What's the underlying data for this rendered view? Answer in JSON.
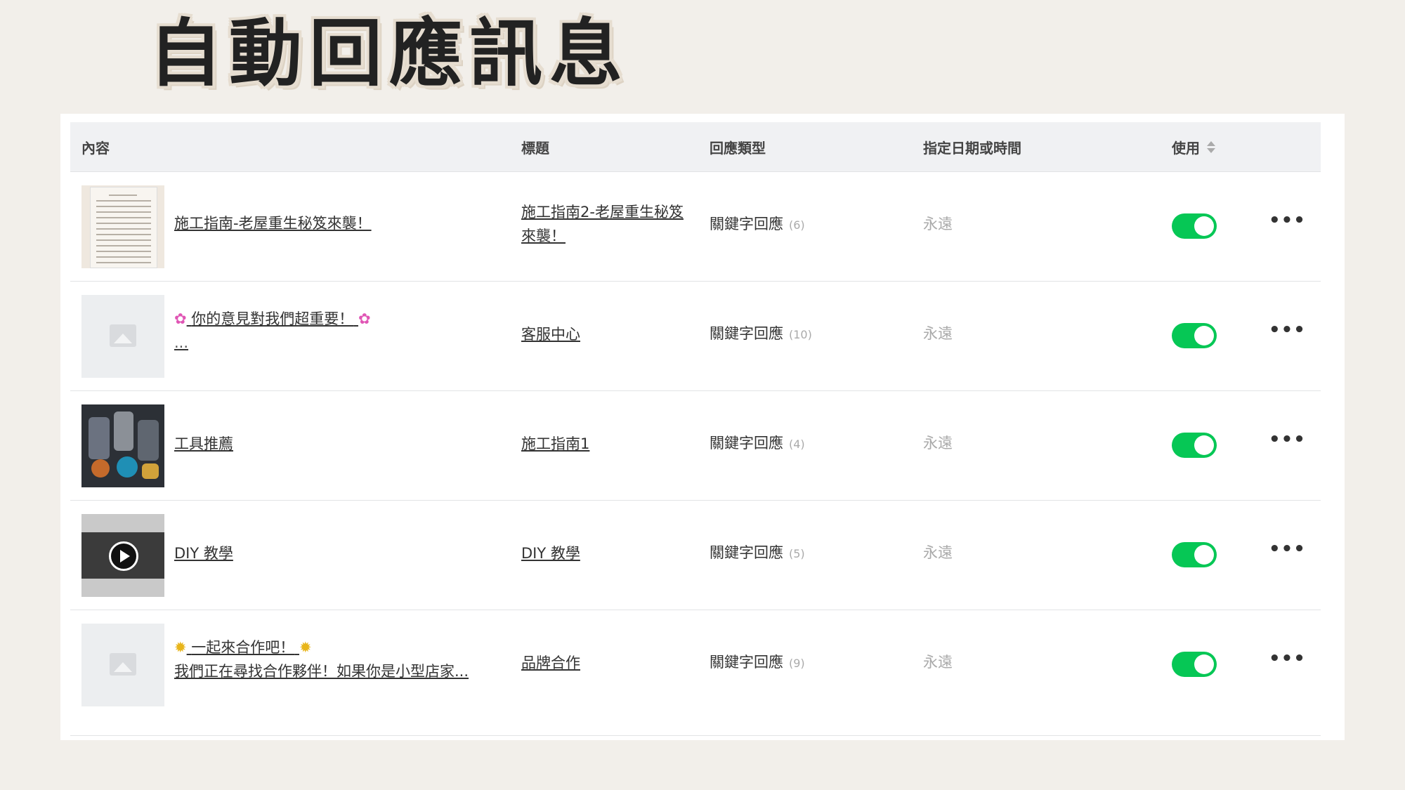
{
  "page_title": "自動回應訊息",
  "table": {
    "headers": {
      "content": "內容",
      "title": "標題",
      "type": "回應類型",
      "date": "指定日期或時間",
      "enabled": "使用"
    },
    "rows": [
      {
        "thumbnail": "document-image",
        "content_line1": "施工指南-老屋重生秘笈來襲！",
        "content_line2": "",
        "title": "施工指南2-老屋重生秘笈來襲！",
        "type": "關鍵字回應",
        "count": "(6)",
        "date": "永遠",
        "enabled": true
      },
      {
        "thumbnail": "placeholder-image",
        "content_prefix_icon": "flower-emoji",
        "content_line1": "你的意見對我們超重要！",
        "content_line2": "...",
        "title": "客服中心",
        "type": "關鍵字回應",
        "count": "(10)",
        "date": "永遠",
        "enabled": true
      },
      {
        "thumbnail": "tools-photo",
        "content_line1": "工具推薦",
        "content_line2": "",
        "title": "施工指南1",
        "type": "關鍵字回應",
        "count": "(4)",
        "date": "永遠",
        "enabled": true
      },
      {
        "thumbnail": "video-thumbnail",
        "content_line1": "DIY 教學",
        "content_line2": "",
        "title": "DIY 教學",
        "type": "關鍵字回應",
        "count": "(5)",
        "date": "永遠",
        "enabled": true
      },
      {
        "thumbnail": "placeholder-image",
        "content_prefix_icon": "sun-emoji",
        "content_line1": "一起來合作吧！",
        "content_line2": "我們正在尋找合作夥伴！如果你是小型店家...",
        "title": "品牌合作",
        "type": "關鍵字回應",
        "count": "(9)",
        "date": "永遠",
        "enabled": true
      }
    ]
  },
  "icons": {
    "flower": "✿",
    "sun": "✹",
    "more": "•••"
  },
  "colors": {
    "toggle_on": "#06c755",
    "background": "#f2efea",
    "header_bg": "#f0f1f3"
  }
}
